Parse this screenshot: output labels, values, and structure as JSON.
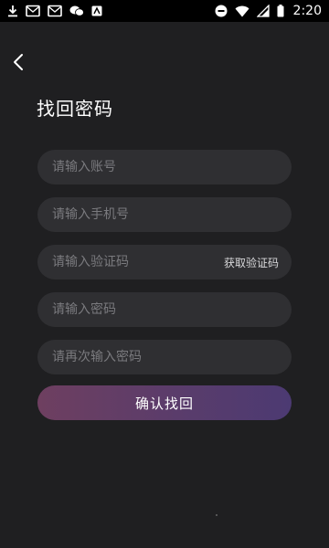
{
  "status_bar": {
    "time": "2:20",
    "left_icons": [
      "download-icon",
      "mail-icon",
      "mail-icon",
      "wechat-icon",
      "app-icon"
    ],
    "right_icons": [
      "do-not-disturb-icon",
      "wifi-icon",
      "signal-icon",
      "battery-icon"
    ]
  },
  "page": {
    "title": "找回密码"
  },
  "form": {
    "account_placeholder": "请输入账号",
    "phone_placeholder": "请输入手机号",
    "code_placeholder": "请输入验证码",
    "get_code_label": "获取验证码",
    "password_placeholder": "请输入密码",
    "confirm_password_placeholder": "请再次输入密码",
    "submit_label": "确认找回"
  },
  "colors": {
    "background": "#1f1f21",
    "field_bg": "#2f2f32",
    "button_gradient_start": "#6e3f60",
    "button_gradient_end": "#4c3a72"
  }
}
